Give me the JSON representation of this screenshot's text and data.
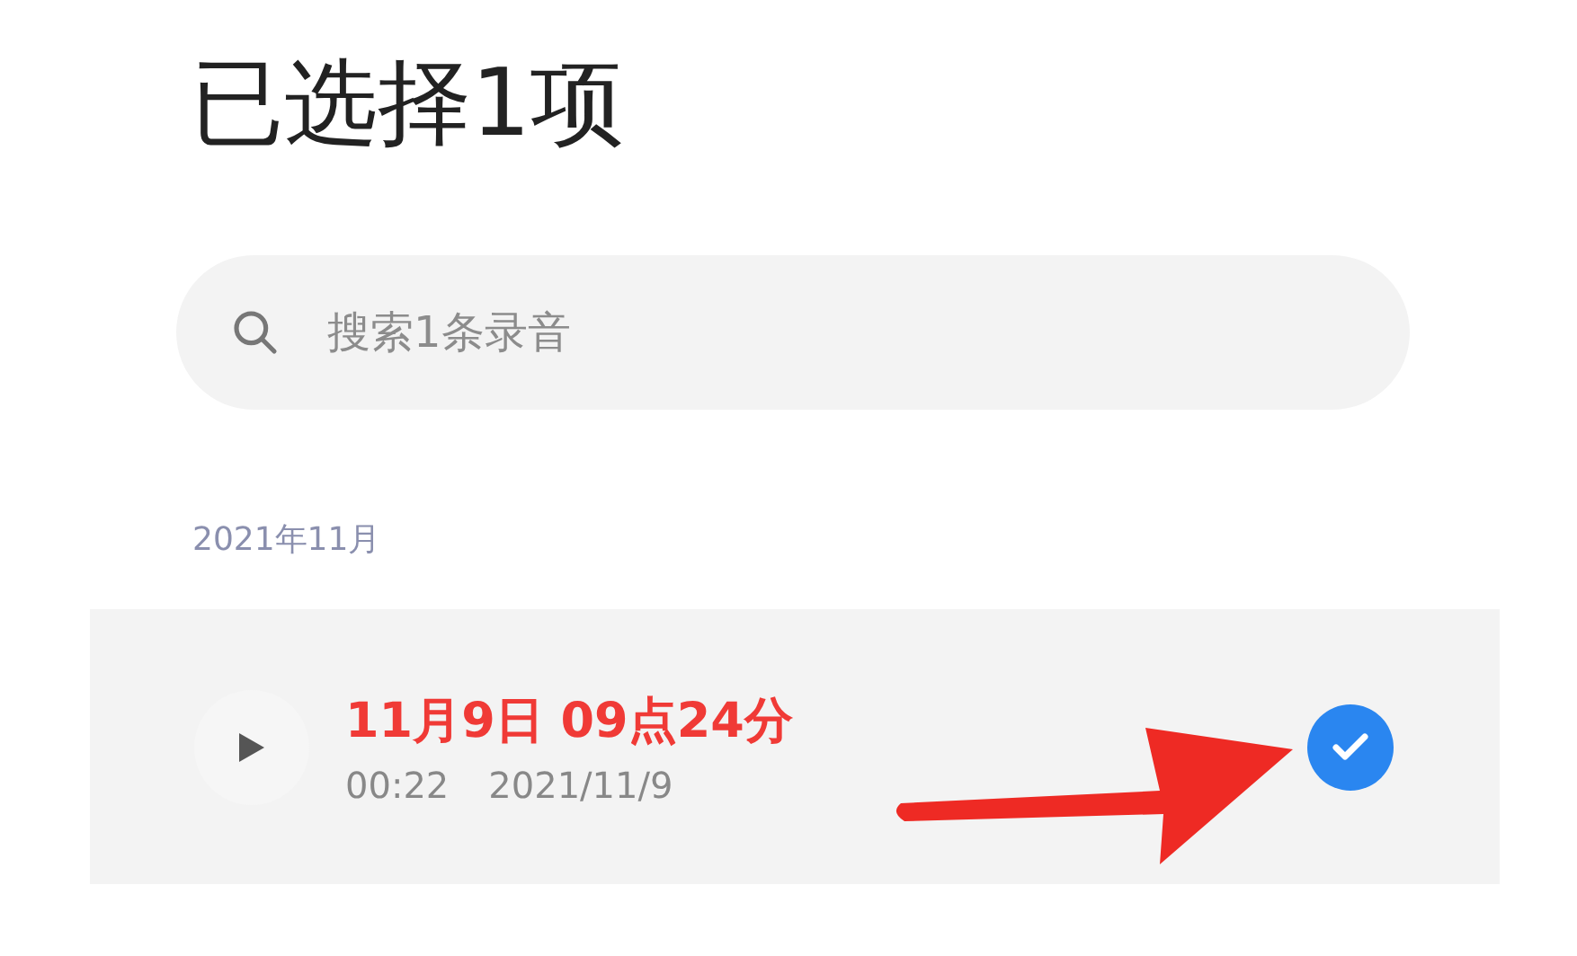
{
  "title": "已选择1项",
  "search": {
    "placeholder": "搜索1条录音"
  },
  "sections": [
    {
      "label": "2021年11月",
      "recordings": [
        {
          "title": "11月9日 09点24分",
          "duration": "00:22",
          "date": "2021/11/9",
          "selected": true
        }
      ]
    }
  ]
}
